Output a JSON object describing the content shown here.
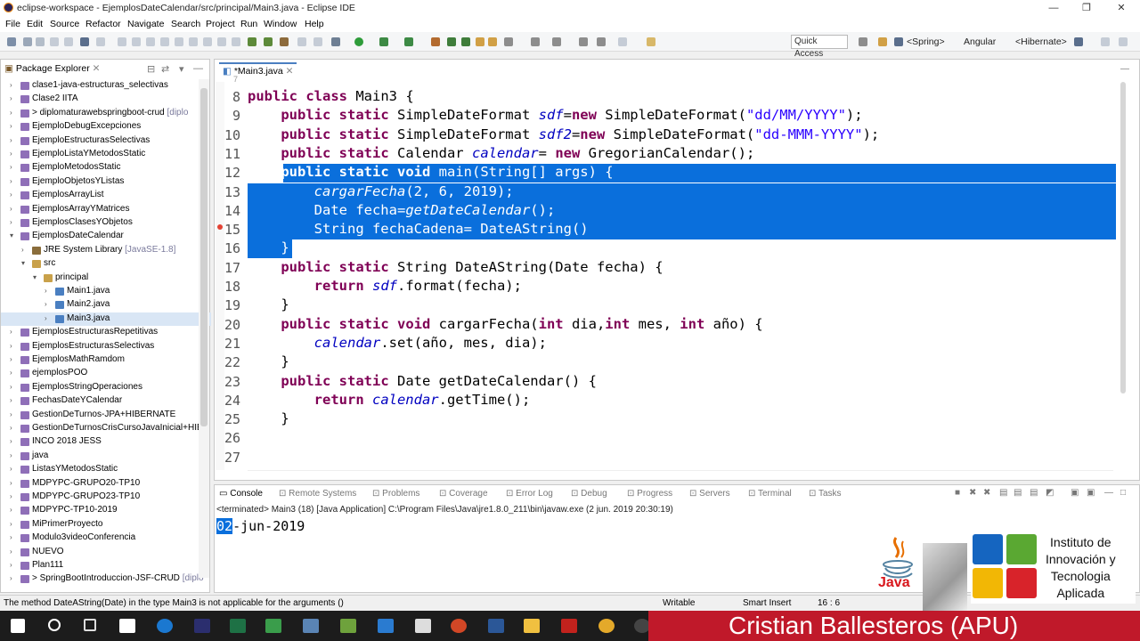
{
  "window": {
    "title": "eclipse-workspace - EjemplosDateCalendar/src/principal/Main3.java - Eclipse IDE",
    "controls": [
      "—",
      "❐",
      "✕"
    ]
  },
  "menu": [
    "File",
    "Edit",
    "Source",
    "Refactor",
    "Navigate",
    "Search",
    "Project",
    "Run",
    "Window",
    "Help"
  ],
  "toolbar": {
    "quick_access": "Quick Access",
    "perspectives": [
      "<Spring>",
      "Angular",
      "<Hibernate>"
    ]
  },
  "package_explorer": {
    "tab_label": "Package Explorer",
    "items": [
      {
        "label": "clase1-java-estructuras_selectivas",
        "deco": "",
        "level": 0,
        "expanded": false
      },
      {
        "label": "Clase2 IITA",
        "deco": "",
        "level": 0,
        "expanded": false
      },
      {
        "label": "> diplomaturawebspringboot-crud",
        "deco": "[diplo",
        "level": 0,
        "expanded": false
      },
      {
        "label": "EjemploDebugExcepciones",
        "deco": "",
        "level": 0,
        "expanded": false
      },
      {
        "label": "EjemploEstructurasSelectivas",
        "deco": "",
        "level": 0,
        "expanded": false
      },
      {
        "label": "EjemploListaYMetodosStatic",
        "deco": "",
        "level": 0,
        "expanded": false
      },
      {
        "label": "EjemploMetodosStatic",
        "deco": "",
        "level": 0,
        "expanded": false
      },
      {
        "label": "EjemploObjetosYListas",
        "deco": "",
        "level": 0,
        "expanded": false
      },
      {
        "label": "EjemplosArrayList",
        "deco": "",
        "level": 0,
        "expanded": false
      },
      {
        "label": "EjemplosArrayYMatrices",
        "deco": "",
        "level": 0,
        "expanded": false
      },
      {
        "label": "EjemplosClasesYObjetos",
        "deco": "",
        "level": 0,
        "expanded": false
      },
      {
        "label": "EjemplosDateCalendar",
        "deco": "",
        "level": 0,
        "expanded": true
      },
      {
        "label": "JRE System Library",
        "deco": "[JavaSE-1.8]",
        "level": 1,
        "expanded": false
      },
      {
        "label": "src",
        "deco": "",
        "level": 1,
        "expanded": true
      },
      {
        "label": "principal",
        "deco": "",
        "level": 2,
        "expanded": true
      },
      {
        "label": "Main1.java",
        "deco": "",
        "level": 3,
        "expanded": false
      },
      {
        "label": "Main2.java",
        "deco": "",
        "level": 3,
        "expanded": false
      },
      {
        "label": "Main3.java",
        "deco": "",
        "level": 3,
        "expanded": false,
        "selected": true
      },
      {
        "label": "EjemplosEstructurasRepetitivas",
        "deco": "",
        "level": 0,
        "expanded": false
      },
      {
        "label": "EjemplosEstructurasSelectivas",
        "deco": "",
        "level": 0,
        "expanded": false
      },
      {
        "label": "EjemplosMathRamdom",
        "deco": "",
        "level": 0,
        "expanded": false
      },
      {
        "label": "ejemplosPOO",
        "deco": "",
        "level": 0,
        "expanded": false
      },
      {
        "label": "EjemplosStringOperaciones",
        "deco": "",
        "level": 0,
        "expanded": false
      },
      {
        "label": "FechasDateYCalendar",
        "deco": "",
        "level": 0,
        "expanded": false
      },
      {
        "label": "GestionDeTurnos-JPA+HIBERNATE",
        "deco": "",
        "level": 0,
        "expanded": false
      },
      {
        "label": "GestionDeTurnosCrisCursoJavaInicial+HIBE",
        "deco": "",
        "level": 0,
        "expanded": false
      },
      {
        "label": "INCO 2018 JESS",
        "deco": "",
        "level": 0,
        "expanded": false
      },
      {
        "label": "java",
        "deco": "",
        "level": 0,
        "expanded": false
      },
      {
        "label": "ListasYMetodosStatic",
        "deco": "",
        "level": 0,
        "expanded": false
      },
      {
        "label": "MDPYPC-GRUPO20-TP10",
        "deco": "",
        "level": 0,
        "expanded": false
      },
      {
        "label": "MDPYPC-GRUPO23-TP10",
        "deco": "",
        "level": 0,
        "expanded": false
      },
      {
        "label": "MDPYPC-TP10-2019",
        "deco": "",
        "level": 0,
        "expanded": false
      },
      {
        "label": "MiPrimerProyecto",
        "deco": "",
        "level": 0,
        "expanded": false
      },
      {
        "label": "Modulo3videoConferencia",
        "deco": "",
        "level": 0,
        "expanded": false
      },
      {
        "label": "NUEVO",
        "deco": "",
        "level": 0,
        "expanded": false
      },
      {
        "label": "Plan111",
        "deco": "",
        "level": 0,
        "expanded": false
      },
      {
        "label": "> SpringBootIntroduccion-JSF-CRUD",
        "deco": "[diplo",
        "level": 0,
        "expanded": false
      }
    ]
  },
  "editor": {
    "tab_label": "*Main3.java",
    "top_partial_line_number": "7",
    "lines": [
      {
        "n": "8",
        "tokens": [
          [
            "kw",
            "public "
          ],
          [
            "kw",
            "class "
          ],
          [
            "",
            "Main3 {"
          ]
        ]
      },
      {
        "n": "9",
        "tokens": [
          [
            "",
            "    "
          ],
          [
            "kw",
            "public "
          ],
          [
            "kw",
            "static "
          ],
          [
            "",
            "SimpleDateFormat "
          ],
          [
            "fld",
            "sdf"
          ],
          [
            "",
            "="
          ],
          [
            "kw",
            "new "
          ],
          [
            "",
            "SimpleDateFormat("
          ],
          [
            "str",
            "\"dd/MM/YYYY\""
          ],
          [
            "",
            ");"
          ]
        ]
      },
      {
        "n": "10",
        "tokens": [
          [
            "",
            "    "
          ],
          [
            "kw",
            "public "
          ],
          [
            "kw",
            "static "
          ],
          [
            "",
            "SimpleDateFormat "
          ],
          [
            "fld",
            "sdf2"
          ],
          [
            "",
            "="
          ],
          [
            "kw",
            "new "
          ],
          [
            "",
            "SimpleDateFormat("
          ],
          [
            "str",
            "\"dd-MMM-YYYY\""
          ],
          [
            "",
            ");"
          ]
        ]
      },
      {
        "n": "11",
        "tokens": [
          [
            "",
            "    "
          ],
          [
            "kw",
            "public "
          ],
          [
            "kw",
            "static "
          ],
          [
            "",
            "Calendar "
          ],
          [
            "fld",
            "calendar"
          ],
          [
            "",
            "= "
          ],
          [
            "kw",
            "new "
          ],
          [
            "",
            "GregorianCalendar();"
          ]
        ]
      },
      {
        "n": "12",
        "sel": true,
        "tokens": [
          [
            "",
            "    "
          ],
          [
            "kw",
            "public "
          ],
          [
            "kw",
            "static "
          ],
          [
            "kw",
            "void "
          ],
          [
            "",
            "main(String[] args) {"
          ]
        ]
      },
      {
        "n": "13",
        "sel": true,
        "tokens": [
          [
            "",
            "        "
          ],
          [
            "st",
            "cargarFecha"
          ],
          [
            "",
            "(2, 6, 2019);"
          ]
        ]
      },
      {
        "n": "14",
        "sel": true,
        "tokens": [
          [
            "",
            "        Date fecha="
          ],
          [
            "st",
            "getDateCalendar"
          ],
          [
            "",
            "();"
          ]
        ]
      },
      {
        "n": "15",
        "sel": true,
        "err": true,
        "tokens": [
          [
            "",
            "        String fechaCadena= DateAString()"
          ]
        ]
      },
      {
        "n": "16",
        "sel": true,
        "tokens": [
          [
            "",
            "    }"
          ]
        ]
      },
      {
        "n": "17",
        "tokens": [
          [
            "",
            "    "
          ],
          [
            "kw",
            "public "
          ],
          [
            "kw",
            "static "
          ],
          [
            "",
            "String DateAString(Date fecha) {"
          ]
        ]
      },
      {
        "n": "18",
        "tokens": [
          [
            "",
            "        "
          ],
          [
            "kw",
            "return "
          ],
          [
            "fld",
            "sdf"
          ],
          [
            "",
            ".format(fecha);"
          ]
        ]
      },
      {
        "n": "19",
        "tokens": [
          [
            "",
            "    }"
          ]
        ]
      },
      {
        "n": "20",
        "tokens": [
          [
            "",
            "    "
          ],
          [
            "kw",
            "public "
          ],
          [
            "kw",
            "static "
          ],
          [
            "kw",
            "void "
          ],
          [
            "",
            "cargarFecha("
          ],
          [
            "kw",
            "int "
          ],
          [
            "",
            "dia,"
          ],
          [
            "kw",
            "int "
          ],
          [
            "",
            "mes, "
          ],
          [
            "kw",
            "int "
          ],
          [
            "",
            "año) {"
          ]
        ]
      },
      {
        "n": "21",
        "tokens": [
          [
            "",
            "        "
          ],
          [
            "fld",
            "calendar"
          ],
          [
            "",
            ".set(año, mes, dia);"
          ]
        ]
      },
      {
        "n": "22",
        "tokens": [
          [
            "",
            "    }"
          ]
        ]
      },
      {
        "n": "23",
        "tokens": [
          [
            "",
            "    "
          ],
          [
            "kw",
            "public "
          ],
          [
            "kw",
            "static "
          ],
          [
            "",
            "Date getDateCalendar() {"
          ]
        ]
      },
      {
        "n": "24",
        "tokens": [
          [
            "",
            "        "
          ],
          [
            "kw",
            "return "
          ],
          [
            "fld",
            "calendar"
          ],
          [
            "",
            ".getTime();"
          ]
        ]
      },
      {
        "n": "25",
        "tokens": [
          [
            "",
            "    }"
          ]
        ]
      },
      {
        "n": "26",
        "tokens": [
          [
            "",
            ""
          ]
        ]
      },
      {
        "n": "27",
        "tokens": [
          [
            "",
            ""
          ]
        ]
      }
    ]
  },
  "console": {
    "tabs": [
      "Console",
      "Remote Systems",
      "Problems",
      "Coverage",
      "Error Log",
      "Debug",
      "Progress",
      "Servers",
      "Terminal",
      "Tasks"
    ],
    "info": "<terminated> Main3 (18) [Java Application] C:\\Program Files\\Java\\jre1.8.0_211\\bin\\javaw.exe (2 jun. 2019 20:30:19)",
    "output_highlight": "02",
    "output_rest": "-jun-2019"
  },
  "status": {
    "message": "The method DateAString(Date) in the type Main3 is not applicable for the arguments ()",
    "writable": "Writable",
    "insert_mode": "Smart Insert",
    "position": "16 : 6"
  },
  "overlay": {
    "java_label": "Java",
    "institute": "Instituto de\nInnovación y\nTecnologia\nAplicada",
    "presenter": "Cristian Ballesteros (APU)"
  }
}
